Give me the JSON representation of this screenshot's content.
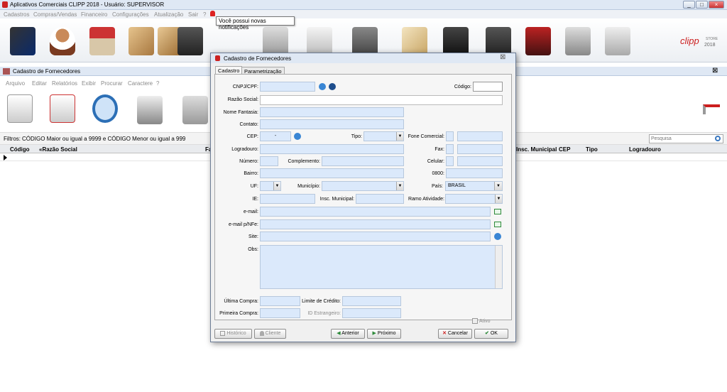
{
  "main": {
    "title": "Aplicativos Comerciais CLIPP 2018 - Usuário: SUPERVISOR",
    "menu": [
      "Cadastros",
      "Compras/Vendas",
      "Financeiro",
      "Configurações",
      "Atualização",
      "Sair",
      "?"
    ],
    "notification": "Você possui novas notificações",
    "brand": "clipp",
    "brand_store": "STORE",
    "brand_year": "2018",
    "window_buttons": [
      "_",
      "□",
      "×"
    ]
  },
  "child": {
    "title": "Cadastro de Fornecedores",
    "menu": [
      "Arquivo",
      "Editar",
      "Relatórios",
      "Exibir",
      "Procurar",
      "Caractere",
      "?"
    ],
    "filter_label": "Filtros:",
    "filter_text": "CÓDIGO Maior ou igual a 9999 e CÓDIGO Menor ou igual a 999",
    "search_placeholder": "Pesquisa",
    "columns": {
      "codigo": "Código",
      "razao": "«Razão Social",
      "fa": "Fa",
      "insc": "Insc. Municipal",
      "cep": "CEP",
      "tipo": "Tipo",
      "logradouro": "Logradouro"
    },
    "close": "⊠"
  },
  "dialog": {
    "title": "Cadastro de Fornecedores",
    "close": "⊠",
    "tabs": [
      "Cadastro",
      "Parametrização"
    ],
    "labels": {
      "cnpj": "CNPJ/CPF:",
      "codigo": "Código:",
      "razao": "Razão Social:",
      "fantasia": "Nome Fantasia:",
      "contato": "Contato:",
      "cep": "CEP:",
      "tipo": "Tipo:",
      "fone": "Fone Comercial:",
      "logradouro": "Logradouro:",
      "fax": "Fax:",
      "numero": "Número:",
      "complemento": "Complemento:",
      "celular": "Celular:",
      "bairro": "Bairro:",
      "zero800": "0800:",
      "uf": "UF:",
      "municipio": "Município:",
      "pais": "País:",
      "ie": "IE:",
      "insc": "Insc. Municipal:",
      "ramo": "Ramo Atividade:",
      "email": "e-mail:",
      "email_nfe": "e-mail p/NFe:",
      "site": "Site:",
      "obs": "Obs:",
      "ultima_compra": "Última Compra:",
      "limite": "Limite de Crédito:",
      "primeira_compra": "Primeira Compra:",
      "id_estrangeiro": "ID Estrangeiro:",
      "ativo": "Ativo"
    },
    "values": {
      "cep": "-",
      "pais": "BRASIL"
    },
    "buttons": {
      "historico": "Histórico",
      "cliente": "Cliente",
      "anterior": "Anterior",
      "proximo": "Próximo",
      "cancelar": "Cancelar",
      "ok": "OK"
    }
  },
  "colors": {
    "field_bg": "#dbe9fb",
    "titlebar": "#dfe8f4",
    "accent_red": "#cc1e1e"
  }
}
